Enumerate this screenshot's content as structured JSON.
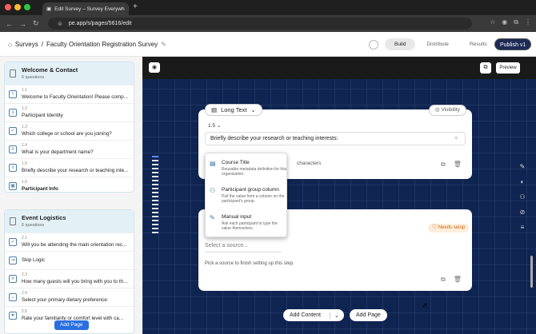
{
  "browser": {
    "tab_title": "Edit Survey – Survey Everywh",
    "url": "pe.app/s/pages/5616/edit",
    "new_tab": "+"
  },
  "header": {
    "breadcrumb_root": "Surveys",
    "breadcrumb_sep": "/",
    "survey_title": "Faculty Orientation Registration Survey",
    "modes": [
      "Build",
      "Distribute",
      "Results"
    ],
    "active_mode": "Build",
    "publish_label": "Publish v1"
  },
  "sections": [
    {
      "title": "Welcome & Contact",
      "subtitle": "6 questions",
      "questions": [
        {
          "num": "1.1",
          "text": "Welcome to Faculty Orientation! Please comp...",
          "icon": "I"
        },
        {
          "num": "1.2",
          "text": "Participant Identity",
          "icon": "≡"
        },
        {
          "num": "1.3",
          "text": "Which college or school are you joining?",
          "icon": "✓"
        },
        {
          "num": "1.4",
          "text": "What is your department name?",
          "icon": "≡"
        },
        {
          "num": "1.5",
          "text": "Briefly describe your research or teaching inte...",
          "icon": "≡"
        },
        {
          "num": "1.6",
          "text": "Participant Info",
          "icon": "▣"
        }
      ]
    },
    {
      "title": "Event Logistics",
      "subtitle": "6 questions",
      "questions": [
        {
          "num": "2.1",
          "text": "Will you be attending the main orientation rec...",
          "icon": "✓"
        },
        {
          "num": "",
          "text": "Skip Logic",
          "icon": "⇥"
        },
        {
          "num": "2.3",
          "text": "How many guests will you bring with you to th...",
          "icon": "#"
        },
        {
          "num": "2.4",
          "text": "Select your primary dietary preference:",
          "icon": "⌄"
        },
        {
          "num": "2.5",
          "text": "Rate your familiarity or comfort level with ca...",
          "icon": "★"
        }
      ]
    }
  ],
  "sidebar": {
    "add_page": "Add Page"
  },
  "canvas": {
    "preview_label": "Preview"
  },
  "card1": {
    "type_label": "Long Text",
    "visibility_label": "Visibility",
    "number": "1.5",
    "question_text": "Briefly describe your research or teaching interests:",
    "char_hint": "characters"
  },
  "dropdown": {
    "options": [
      {
        "title": "Course Title",
        "desc": "Reusable metadata definition for this organization."
      },
      {
        "title": "Participant group column",
        "desc": "Pull the value from a column on the participant's group."
      },
      {
        "title": "Manual input",
        "desc": "Ask each participant to type the value themselves."
      }
    ]
  },
  "card2": {
    "needs_setup": "Needs setup",
    "source_placeholder": "Select a source...",
    "hint": "Pick a source to finish setting up this step."
  },
  "footer": {
    "add_content": "Add Content",
    "add_page": "Add Page"
  },
  "colors": {
    "canvas_bg": "#0f2450",
    "publish_bg": "#1e2a55",
    "needs_setup": "#c66a12"
  }
}
